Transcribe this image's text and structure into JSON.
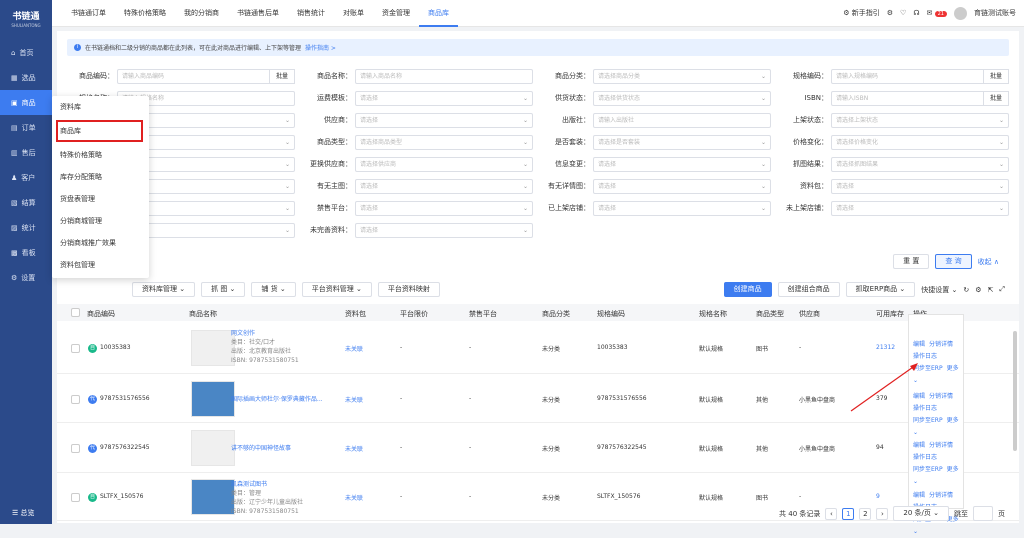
{
  "sidebar": {
    "logo": "书链通",
    "logo_sub": "SHULIANTONG",
    "items": [
      {
        "label": "首页"
      },
      {
        "label": "选品"
      },
      {
        "label": "商品"
      },
      {
        "label": "订单"
      },
      {
        "label": "售后"
      },
      {
        "label": "客户"
      },
      {
        "label": "结算"
      },
      {
        "label": "统计"
      },
      {
        "label": "看板"
      },
      {
        "label": "设置"
      }
    ],
    "footer": "总览"
  },
  "topnav": {
    "tabs": [
      "书链通订单",
      "特殊价格策略",
      "我的分销商",
      "书链通售后单",
      "销售统计",
      "对账单",
      "资金管理",
      "商品库"
    ],
    "active": 7,
    "guide": "新手指引",
    "badge": "21",
    "account": "育链测试账号"
  },
  "tip": {
    "text": "在书链通档和二级分销的商品都在此列表，可在此对商品进行编辑、上下架等管理",
    "link": "操作指南 >"
  },
  "filters": [
    [
      {
        "label": "商品编码：",
        "ph": "请输入商品编码",
        "btn": "批量"
      },
      {
        "label": "商品名称：",
        "ph": "请输入商品名称"
      },
      {
        "label": "商品分类：",
        "ph": "请选择商品分类",
        "dd": true
      },
      {
        "label": "规格编码：",
        "ph": "请输入规格编码",
        "btn": "批量"
      }
    ],
    [
      {
        "label": "规格名称：",
        "ph": "请输入规格名称"
      },
      {
        "label": "运费模板：",
        "ph": "请选择",
        "dd": true
      },
      {
        "label": "供货状态：",
        "ph": "请选择供货状态",
        "dd": true
      },
      {
        "label": "ISBN：",
        "ph": "请输入ISBN",
        "btn": "批量"
      }
    ],
    [
      {
        "label": "",
        "ph": "请选择",
        "dd": true
      },
      {
        "label": "供应商：",
        "ph": "请选择",
        "dd": true
      },
      {
        "label": "出版社：",
        "ph": "请输入出版社"
      },
      {
        "label": "上架状态：",
        "ph": "请选择上架状态",
        "dd": true
      }
    ],
    [
      {
        "label": "",
        "ph": "请选择",
        "dd": true
      },
      {
        "label": "商品类型：",
        "ph": "请选择商品类型",
        "dd": true
      },
      {
        "label": "是否套装：",
        "ph": "请选择是否套装",
        "dd": true
      },
      {
        "label": "价格变化：",
        "ph": "请选择价格变化",
        "dd": true
      }
    ],
    [
      {
        "label": "",
        "ph": "请选择",
        "dd": true
      },
      {
        "label": "更换供应商：",
        "ph": "请选择供应商",
        "dd": true
      },
      {
        "label": "信息变更：",
        "ph": "请选择",
        "dd": true
      },
      {
        "label": "抓图结果：",
        "ph": "请选择抓图结果",
        "dd": true
      }
    ],
    [
      {
        "label": "",
        "ph": "",
        "dd": true
      },
      {
        "label": "有无主图：",
        "ph": "请选择",
        "dd": true
      },
      {
        "label": "有无详情图：",
        "ph": "请选择",
        "dd": true
      },
      {
        "label": "资料包：",
        "ph": "请选择",
        "dd": true
      }
    ],
    [
      {
        "label": "",
        "ph": "",
        "dd": true
      },
      {
        "label": "禁售平台：",
        "ph": "请选择",
        "dd": true
      },
      {
        "label": "已上架店铺：",
        "ph": "请选择",
        "dd": true
      },
      {
        "label": "未上架店铺：",
        "ph": "请选择",
        "dd": true
      }
    ],
    [
      {
        "label": "",
        "ph": "",
        "dd": true
      },
      {
        "label": "未完善资料：",
        "ph": "请选择",
        "dd": true
      }
    ]
  ],
  "actions": {
    "reset": "重 置",
    "search": "查 询",
    "collapse": "收起 ∧"
  },
  "toolbar": {
    "left": [
      "资料库管理 ⌄",
      "抓 图 ⌄",
      "铺 货 ⌄",
      "平台资料管理 ⌄",
      "平台资料映射"
    ],
    "create": "创建商品",
    "combo": "创建组合商品",
    "erp": "抓取ERP商品 ⌄",
    "quick": "快捷设置 ⌄"
  },
  "table": {
    "headers": [
      "商品编码",
      "商品名称",
      "资料包",
      "平台限价",
      "禁售平台",
      "商品分类",
      "规格编码",
      "规格名称",
      "商品类型",
      "供应商",
      "可用库存",
      "操作"
    ],
    "rows": [
      {
        "tag": "自",
        "code": "10035383",
        "title": "网文创作",
        "l1": "类目：社交/口才",
        "l2": "出版：北京教育出版社",
        "l3": "ISBN: 9787531580751",
        "pkg": "未关联",
        "lim": "-",
        "ban": "-",
        "cat": "未分类",
        "sku": "10035383",
        "spec": "默认规格",
        "type": "图书",
        "sup": "-",
        "stock": "21312"
      },
      {
        "tag": "代",
        "code": "9787531576556",
        "title": "国际插画大师杜尔·保罗典藏作品...",
        "l1": "",
        "l2": "",
        "l3": "",
        "pkg": "未关联",
        "lim": "-",
        "ban": "-",
        "cat": "未分类",
        "sku": "9787531576556",
        "spec": "默认规格",
        "type": "其他",
        "sup": "小黑鱼中盘商",
        "stock": "379"
      },
      {
        "tag": "代",
        "code": "9787576322545",
        "title": "讲不够的中国神怪故事",
        "l1": "",
        "l2": "",
        "l3": "",
        "pkg": "未关联",
        "lim": "-",
        "ban": "-",
        "cat": "未分类",
        "sku": "9787576322545",
        "spec": "默认规格",
        "type": "其他",
        "sup": "小黑鱼中盘商",
        "stock": "94"
      },
      {
        "tag": "自",
        "code": "SLTFX_150576",
        "title": "凯森测试图书",
        "l1": "类目：管理",
        "l2": "出版：辽宁少年儿童出版社",
        "l3": "ISBN: 9787531580751",
        "pkg": "未关联",
        "lim": "-",
        "ban": "-",
        "cat": "未分类",
        "sku": "SLTFX_150576",
        "spec": "默认规格",
        "type": "图书",
        "sup": "-",
        "stock": "9"
      }
    ],
    "ops": {
      "edit": "编辑",
      "detail": "分销详情",
      "log": "操作日志",
      "sync": "同步至ERP",
      "more": "更多 ⌄"
    }
  },
  "pager": {
    "total": "共 40 条记录",
    "p1": "1",
    "p2": "2",
    "size": "20 条/页 ⌄",
    "jump": "跳至",
    "unit": "页"
  },
  "menu": [
    "资料库",
    "商品库",
    "特殊价格策略",
    "库存分配策略",
    "货盘表管理",
    "分销商城管理",
    "分销商城推广效果",
    "资料包管理"
  ]
}
